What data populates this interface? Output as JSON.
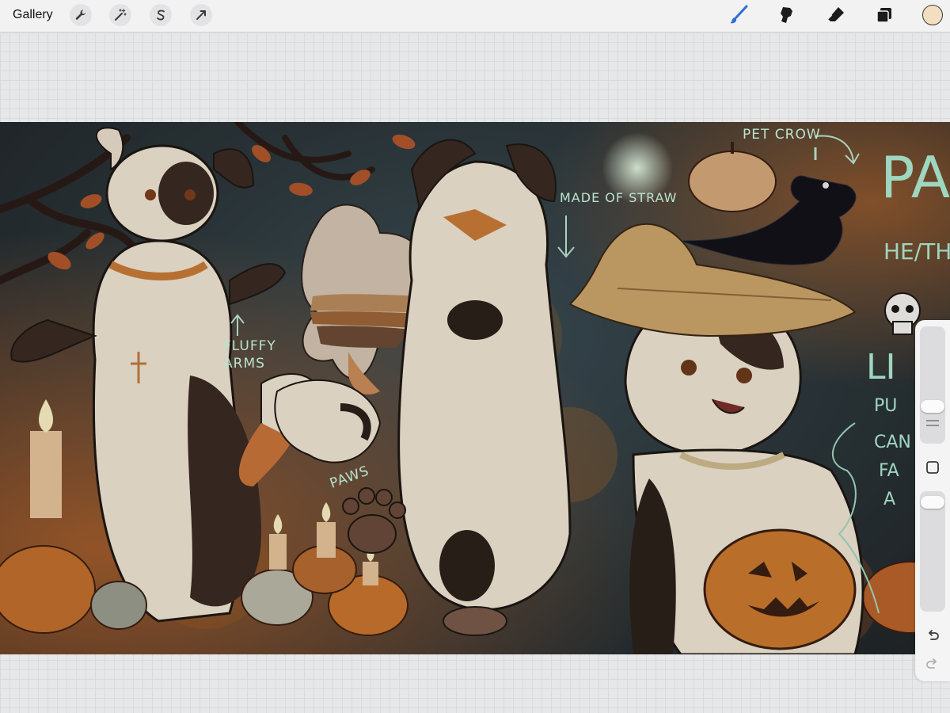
{
  "toolbar": {
    "gallery_label": "Gallery",
    "left_tools": [
      {
        "icon": "wrench-icon"
      },
      {
        "icon": "magic-wand-icon"
      },
      {
        "icon": "selection-s-icon"
      },
      {
        "icon": "transform-arrow-icon"
      }
    ],
    "right_tools": [
      {
        "icon": "brush-icon"
      },
      {
        "icon": "smudge-icon"
      },
      {
        "icon": "eraser-icon"
      },
      {
        "icon": "layers-icon"
      }
    ],
    "current_color": "#f3dfc0",
    "active_tool_color": "#2f6fd6"
  },
  "artwork": {
    "annotations": {
      "pet_crow": "PET CROW",
      "made_of_straw": "MADE OF STRAW",
      "fluffy_arms_line1": "FLUFFY",
      "fluffy_arms_line2": "ARMS",
      "paws": "PAWS",
      "name_partial": "PA",
      "pronouns_partial": "HE/TH",
      "likes_partial": "LI",
      "like_1": "PU",
      "like_2": "CAN",
      "like_3": "FA",
      "like_4": "A"
    }
  },
  "sidebar": {
    "undo_icon": "undo-icon",
    "redo_icon": "redo-icon",
    "modify_icon": "square-modify-icon"
  }
}
